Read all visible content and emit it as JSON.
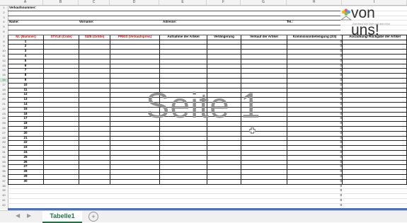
{
  "sheet": {
    "columns": [
      "A",
      "B",
      "C",
      "D",
      "E",
      "F",
      "G",
      "H",
      "I"
    ],
    "row_numbers": [
      "1",
      "2",
      "3",
      "4",
      "5",
      "6",
      "7",
      "8",
      "9",
      "10",
      "11",
      "12",
      "13",
      "14",
      "15",
      "16",
      "17",
      "18",
      "19",
      "20",
      "21",
      "22",
      "23",
      "24",
      "25",
      "26",
      "27",
      "28",
      "29",
      "30",
      "31",
      "32",
      "33",
      "34",
      "35",
      "36",
      "37",
      "38",
      "39",
      "40",
      "41",
      "42"
    ],
    "selected_row": "16",
    "title_cell": "Verkaufsnummer:",
    "name_label": "Name:",
    "vorname_label": "Vorname:",
    "adresse_label": "Adresse:",
    "tel_label": "Tel.:",
    "headers": {
      "nr": "Nr. (Nummer)",
      "style": "STYLE (Code)",
      "size": "SIZE (Größe)",
      "price": "PREIS (Verkaufspreis)",
      "aufnahme": "Aufnahme der Artikel",
      "verlaengerung": "Verlängerung",
      "verkauf": "Verkauf der Artikel",
      "kommission": "Kommissionbeteiligung (2/3)",
      "auszahlung": "Auszahlung/ Rückgabe der Artikel"
    },
    "item_numbers": [
      "1",
      "2",
      "3",
      "4",
      "5",
      "6",
      "7",
      "8",
      "9",
      "10",
      "11",
      "12",
      "13",
      "14",
      "15",
      "16",
      "17",
      "18",
      "19",
      "20",
      "21",
      "22",
      "23",
      "24",
      "25",
      "26",
      "27",
      "28",
      "29",
      "30"
    ],
    "zeros": [
      "0",
      "0",
      "0",
      "0",
      "0",
      "0",
      "0",
      "0",
      "0",
      "0",
      "0",
      "0",
      "0",
      "0",
      "0",
      "0",
      "0",
      "0",
      "0",
      "0",
      "0",
      "0",
      "0",
      "0",
      "0",
      "0",
      "0",
      "0",
      "0",
      "0",
      "0",
      "0",
      "0",
      "0",
      "0"
    ],
    "watermark": "Seite 1"
  },
  "logo": {
    "brand": "von uns!",
    "tagline": "2nd Hand fuer Dich und dein Kind"
  },
  "tabs": {
    "active_tab": "Tabelle1",
    "add_icon": "+",
    "prev_icon": "◀",
    "next_icon": "▶"
  },
  "colors": {
    "accent": "#217346",
    "header_red": "#e00000",
    "page_border": "#4472c4"
  }
}
